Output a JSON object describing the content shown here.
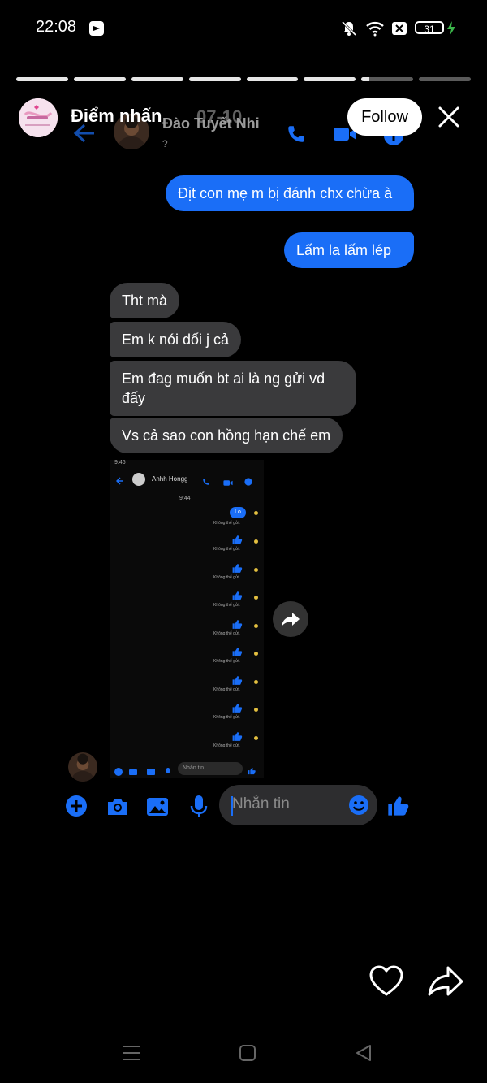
{
  "status_bar": {
    "time": "22:08",
    "battery": "31"
  },
  "story": {
    "segments_total": 8,
    "segments_complete": 6,
    "current_segment_progress": 0.15,
    "title": "Điểm nhấn",
    "date": "07-10",
    "follow_label": "Follow"
  },
  "chat_screenshot": {
    "contact_name": "Đào Tuyết Nhi",
    "contact_sub": "?",
    "messages": [
      {
        "side": "sent",
        "text": "Địt con mẹ m bị đánh chx chừa à"
      },
      {
        "side": "sent",
        "text": "Lấm la lấm lép"
      },
      {
        "side": "received",
        "text": "Tht mà"
      },
      {
        "side": "received",
        "text": "Em k nói dối j cả"
      },
      {
        "side": "received",
        "text": "Em đag muốn bt ai là ng gửi vd đấy"
      },
      {
        "side": "received",
        "text": "Vs cả sao con hồng hạn chế em"
      }
    ],
    "nested": {
      "contact_name": "Anhh Hongg",
      "time": "9:44",
      "first_bubble": "Lo",
      "failed_text": "Không thể gửi.",
      "input_placeholder": "Nhắn tin"
    },
    "input_placeholder": "Nhắn tin"
  },
  "colors": {
    "accent": "#1a6ef7",
    "bubble_received": "#3a3a3c",
    "failed_dot": "#e4c040"
  }
}
